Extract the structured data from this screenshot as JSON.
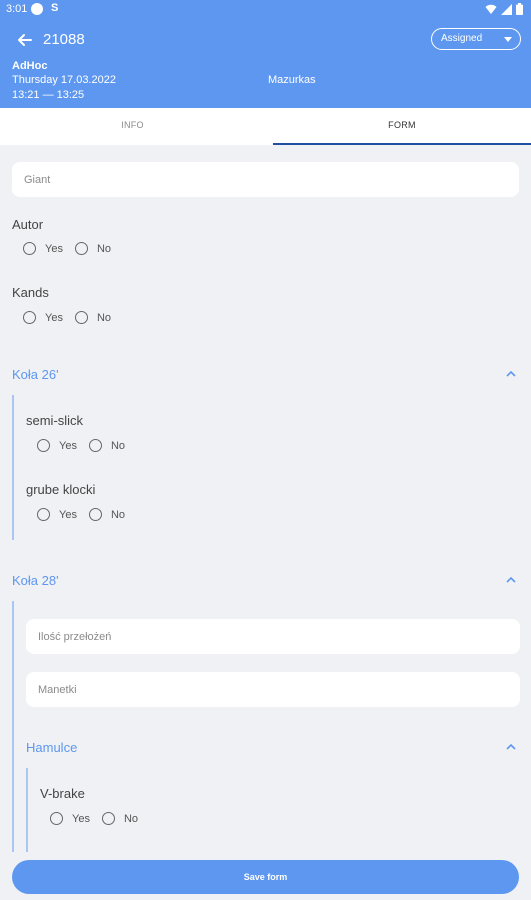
{
  "status_bar": {
    "time": "3:01",
    "app_icon_letter": "S"
  },
  "header": {
    "title": "21088",
    "status_select": "Assigned",
    "order_type": "AdHoc",
    "date": "Thursday 17.03.2022",
    "time_range": "13:21 — 13:25",
    "location": "Mazurkas"
  },
  "tabs": [
    "INFO",
    "FORM"
  ],
  "form": {
    "giant_placeholder": "Giant",
    "autor": {
      "label": "Autor",
      "yes": "Yes",
      "no": "No"
    },
    "kands": {
      "label": "Kands",
      "yes": "Yes",
      "no": "No"
    },
    "section_kola26": {
      "title": "Koła 26'",
      "semi_slick": {
        "label": "semi-slick",
        "yes": "Yes",
        "no": "No"
      },
      "grube_klocki": {
        "label": "grube klocki",
        "yes": "Yes",
        "no": "No"
      }
    },
    "section_kola28": {
      "title": "Koła 28'",
      "ilosc_placeholder": "Ilość przełożeń",
      "manetki_placeholder": "Manetki",
      "section_hamulce": {
        "title": "Hamulce",
        "v_brake": {
          "label": "V-brake",
          "yes": "Yes",
          "no": "No"
        }
      }
    }
  },
  "save_button": "Save form",
  "colors": {
    "primary": "#5e97f0",
    "background": "#eff1f4",
    "tab_indicator": "#1e4fa3"
  }
}
